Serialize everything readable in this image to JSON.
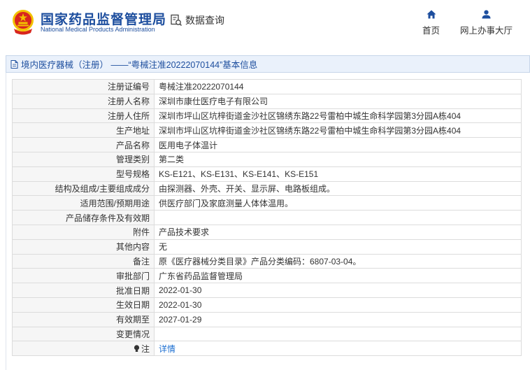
{
  "header": {
    "brand_cn": "国家药品监督管理局",
    "brand_en": "National Medical Products Administration",
    "query_label": "数据查询",
    "nav": [
      {
        "label": "首页",
        "icon": "home-icon"
      },
      {
        "label": "网上办事大厅",
        "icon": "user-icon"
      }
    ]
  },
  "breadcrumb": {
    "icon": "document-icon",
    "text": "境内医疗器械（注册） ——“粤械注准20222070144”基本信息"
  },
  "colors": {
    "brand": "#1d4e9e",
    "emblem_red": "#d8261e",
    "emblem_gold": "#f2c200",
    "link": "#1d6fd1"
  },
  "fields": [
    {
      "label": "注册证编号",
      "value": "粤械注准20222070144"
    },
    {
      "label": "注册人名称",
      "value": "深圳市康仕医疗电子有限公司"
    },
    {
      "label": "注册人住所",
      "value": "深圳市坪山区坑梓街道金沙社区锦绣东路22号雷柏中城生命科学园第3分园A栋404"
    },
    {
      "label": "生产地址",
      "value": "深圳市坪山区坑梓街道金沙社区锦绣东路22号雷柏中城生命科学园第3分园A栋404"
    },
    {
      "label": "产品名称",
      "value": "医用电子体温计"
    },
    {
      "label": "管理类别",
      "value": "第二类"
    },
    {
      "label": "型号规格",
      "value": "KS-E121、KS-E131、KS-E141、KS-E151"
    },
    {
      "label": "结构及组成/主要组成成分",
      "value": "由探测器、外壳、开关、显示屏、电路板组成。"
    },
    {
      "label": "适用范围/预期用途",
      "value": "供医疗部门及家庭测量人体体温用。"
    },
    {
      "label": "产品储存条件及有效期",
      "value": ""
    },
    {
      "label": "附件",
      "value": "产品技术要求"
    },
    {
      "label": "其他内容",
      "value": "无"
    },
    {
      "label": "备注",
      "value": "原《医疗器械分类目录》产品分类编码：6807-03-04。"
    },
    {
      "label": "审批部门",
      "value": "广东省药品监督管理局"
    },
    {
      "label": "批准日期",
      "value": "2022-01-30"
    },
    {
      "label": "生效日期",
      "value": "2022-01-30"
    },
    {
      "label": "有效期至",
      "value": "2027-01-29"
    },
    {
      "label": "变更情况",
      "value": ""
    }
  ],
  "note": {
    "icon": "lightbulb-icon",
    "label": "注",
    "link_text": "详情"
  }
}
